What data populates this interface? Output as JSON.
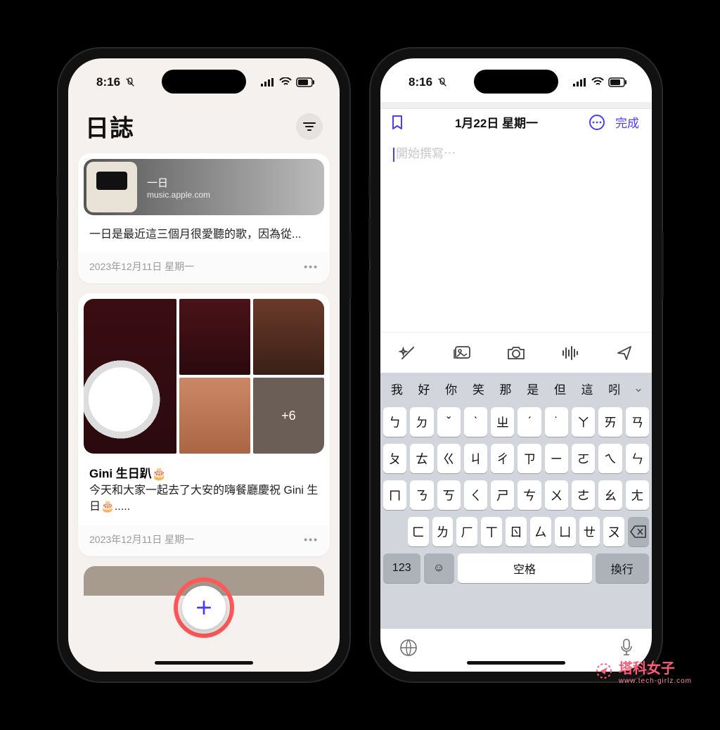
{
  "status": {
    "time": "8:16"
  },
  "left": {
    "title": "日誌",
    "card1": {
      "musicTitle": "一日",
      "musicSource": "music.apple.com",
      "body": "一日是最近這三個月很愛聽的歌，因為從...",
      "date": "2023年12月11日 星期一"
    },
    "card2": {
      "moreCount": "+6",
      "title": "Gini 生日趴🎂",
      "body": "今天和大家一起去了大安的嗨餐廳慶祝 Gini 生日🎂.....",
      "date": "2023年12月11日 星期一"
    }
  },
  "right": {
    "navDate": "1月22日 星期一",
    "done": "完成",
    "placeholder": "開始撰寫⋯"
  },
  "keyboard": {
    "suggestions": [
      "我",
      "好",
      "你",
      "笑",
      "那",
      "是",
      "但",
      "這",
      "吲"
    ],
    "row1": [
      "ㄅ",
      "ㄉ",
      "ˇ",
      "ˋ",
      "ㄓ",
      "ˊ",
      "˙",
      "ㄚ",
      "ㄞ",
      "ㄢ"
    ],
    "row2": [
      "ㄆ",
      "ㄊ",
      "ㄍ",
      "ㄐ",
      "ㄔ",
      "ㄗ",
      "ㄧ",
      "ㄛ",
      "ㄟ",
      "ㄣ"
    ],
    "row3": [
      "ㄇ",
      "ㄋ",
      "ㄎ",
      "ㄑ",
      "ㄕ",
      "ㄘ",
      "ㄨ",
      "ㄜ",
      "ㄠ",
      "ㄤ"
    ],
    "row4": [
      "ㄈ",
      "ㄌ",
      "ㄏ",
      "ㄒ",
      "ㄖ",
      "ㄙ",
      "ㄩ",
      "ㄝ",
      "ㄡ"
    ],
    "modeKey": "123",
    "space": "空格",
    "enter": "換行"
  },
  "watermark": {
    "brand": "塔科女子",
    "url": "www.tech-girlz.com"
  }
}
